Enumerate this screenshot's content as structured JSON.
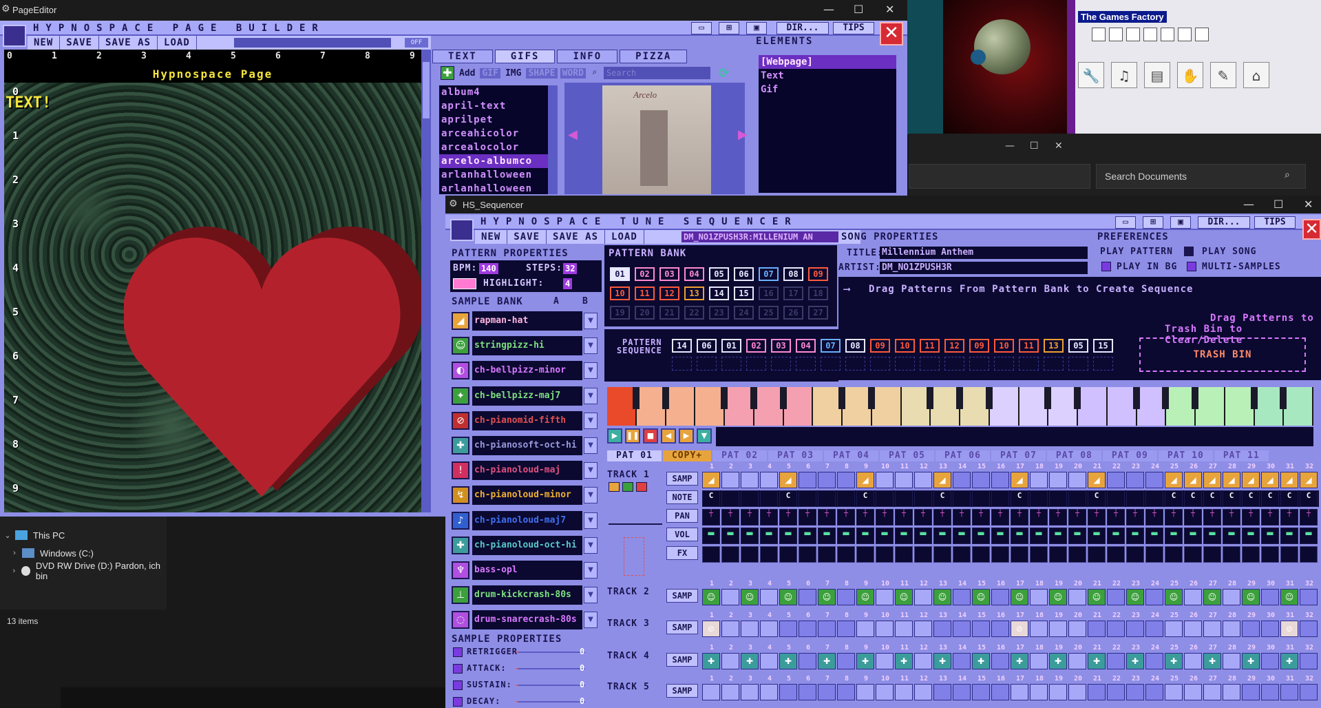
{
  "desktop": {
    "games_factory_title": "The Games Factory",
    "documents_search_placeholder": "Search Documents",
    "explorer": {
      "items": [
        {
          "label": "This PC",
          "level": 0,
          "expanded": true
        },
        {
          "label": "Windows (C:)",
          "level": 1,
          "expanded": false
        },
        {
          "label": "DVD RW Drive (D:) Pardon, ich bin",
          "level": 1,
          "expanded": false
        }
      ],
      "status": "13 items"
    }
  },
  "page_editor": {
    "window_title": "PageEditor",
    "app_title": "HYPNOSPACE PAGE BUILDER",
    "menu": [
      "NEW",
      "SAVE",
      "SAVE AS",
      "LOAD"
    ],
    "toggle_label": "OFF",
    "header_buttons": {
      "dir": "DIR...",
      "tips": "TIPS"
    },
    "page_title": "Hypnospace Page",
    "text_element": "TEXT!",
    "ruler_top": [
      "0",
      "1",
      "2",
      "3",
      "4",
      "5",
      "6",
      "7",
      "8",
      "9"
    ],
    "ruler_left": [
      "0",
      "1",
      "2",
      "3",
      "4",
      "5",
      "6",
      "7",
      "8",
      "9"
    ],
    "tabs": [
      "TEXT",
      "GIFS",
      "INFO",
      "PIZZA"
    ],
    "active_tab": "GIFS",
    "toolbar": {
      "add": "Add",
      "gif": "GIF",
      "img": "IMG",
      "shape": "SHAPE",
      "word": "WORD",
      "search_placeholder": "Search"
    },
    "gifs": [
      "album4",
      "april-text",
      "aprilpet",
      "arceahicolor",
      "arcealocolor",
      "arcelo-albumco",
      "arlanhalloween",
      "arlanhalloween"
    ],
    "selected_gif": "arcelo-albumco",
    "preview_caption": "Arcelo",
    "elements_header": "ELEMENTS",
    "elements": [
      "[Webpage]",
      "Text",
      "Gif"
    ],
    "selected_element": "[Webpage]",
    "colors": {
      "frame": "#8e8ee6",
      "heart": "#b3222c",
      "accent_text": "#f5e53c"
    }
  },
  "sequencer": {
    "window_title": "HS_Sequencer",
    "app_title": "HYPNOSPACE TUNE SEQUENCER",
    "menu": [
      "NEW",
      "SAVE",
      "SAVE AS",
      "LOAD"
    ],
    "song_bar": "DM_NO1ZPUSH3R:MILLENIUM AN",
    "header_buttons": {
      "dir": "DIR...",
      "tips": "TIPS"
    },
    "pattern_properties": {
      "header": "PATTERN PROPERTIES",
      "bpm_label": "BPM:",
      "bpm": "140",
      "steps_label": "STEPS:",
      "steps": "32",
      "highlight_label": "HIGHLIGHT:",
      "highlight": "4"
    },
    "pattern_bank": {
      "header": "PATTERN BANK",
      "cells": [
        "01",
        "02",
        "03",
        "04",
        "05",
        "06",
        "07",
        "08",
        "09",
        "10",
        "11",
        "12",
        "13",
        "14",
        "15",
        "16",
        "17",
        "18",
        "19",
        "20",
        "21",
        "22",
        "23",
        "24",
        "25",
        "26",
        "27"
      ]
    },
    "song_properties": {
      "header": "SONG PROPERTIES",
      "title_label": "TITLE:",
      "title": "Millennium Anthem",
      "artist_label": "ARTIST:",
      "artist": "DM_NO1ZPUSH3R"
    },
    "preferences": {
      "header": "PREFERENCES",
      "play_pattern": "PLAY PATTERN",
      "play_song": "PLAY SONG",
      "play_in_bg": "PLAY IN BG",
      "multi_samples": "MULTI-SAMPLES"
    },
    "drag_hint": "Drag Patterns From Pattern Bank to Create Sequence",
    "trash_hint_1": "Drag Patterns to",
    "trash_hint_2": "Trash Bin to Clear/Delete",
    "trash_bin": "TRASH BIN",
    "pattern_sequence_label_1": "PATTERN",
    "pattern_sequence_label_2": "SEQUENCE",
    "pattern_sequence": [
      "14",
      "06",
      "01",
      "02",
      "03",
      "04",
      "07",
      "08",
      "09",
      "10",
      "11",
      "12",
      "09",
      "10",
      "11",
      "13",
      "05",
      "15"
    ],
    "sample_bank": {
      "header": "SAMPLE BANK",
      "ab": [
        "A",
        "B"
      ],
      "samples": [
        {
          "name": "rapman-hat",
          "color": "#ffb7e0",
          "icon_bg": "#e8a43c",
          "icon": "◢"
        },
        {
          "name": "stringpizz-hi",
          "color": "#7ee07e",
          "icon_bg": "#3ca03c",
          "icon": "☺"
        },
        {
          "name": "ch-bellpizz-minor",
          "color": "#d878ff",
          "icon_bg": "#b04fe0",
          "icon": "◐"
        },
        {
          "name": "ch-bellpizz-maj7",
          "color": "#7ee07e",
          "icon_bg": "#3ca03c",
          "icon": "✦"
        },
        {
          "name": "ch-pianomid-fifth",
          "color": "#e05050",
          "icon_bg": "#c03030",
          "icon": "⊘"
        },
        {
          "name": "ch-pianosoft-oct-hi",
          "color": "#9898d8",
          "icon_bg": "#3c9c9c",
          "icon": "✚"
        },
        {
          "name": "ch-pianoloud-maj",
          "color": "#e05080",
          "icon_bg": "#d03060",
          "icon": "!"
        },
        {
          "name": "ch-pianoloud-minor",
          "color": "#f0b030",
          "icon_bg": "#d09020",
          "icon": "↯"
        },
        {
          "name": "ch-pianoloud-maj7",
          "color": "#4070f0",
          "icon_bg": "#3060d0",
          "icon": "♪"
        },
        {
          "name": "ch-pianoloud-oct-hi",
          "color": "#58c8c8",
          "icon_bg": "#3c9c9c",
          "icon": "✚"
        },
        {
          "name": "bass-opl",
          "color": "#d878ff",
          "icon_bg": "#b04fe0",
          "icon": "♆"
        },
        {
          "name": "drum-kickcrash-80s",
          "color": "#7ee07e",
          "icon_bg": "#3ca03c",
          "icon": "⊥"
        },
        {
          "name": "drum-snarecrash-80s",
          "color": "#d878ff",
          "icon_bg": "#b04fe0",
          "icon": "◌"
        }
      ]
    },
    "sample_properties": {
      "header": "SAMPLE PROPERTIES",
      "rows": [
        {
          "label": "RETRIGGER",
          "value": "0"
        },
        {
          "label": "ATTACK:",
          "value": "0"
        },
        {
          "label": "SUSTAIN:",
          "value": "0"
        },
        {
          "label": "DECAY:",
          "value": "0"
        }
      ]
    },
    "pattern_tabs": [
      "PAT 01",
      "COPY+",
      "PAT 02",
      "PAT 03",
      "PAT 04",
      "PAT 05",
      "PAT 06",
      "PAT 07",
      "PAT 08",
      "PAT 09",
      "PAT 10",
      "PAT 11"
    ],
    "tracks": [
      {
        "label": "TRACK 1",
        "rows": [
          "SAMP",
          "NOTE",
          "PAN",
          "VOL",
          "FX"
        ]
      },
      {
        "label": "TRACK 2",
        "rows": [
          "SAMP"
        ]
      },
      {
        "label": "TRACK 3",
        "rows": [
          "SAMP"
        ]
      },
      {
        "label": "TRACK 4",
        "rows": [
          "SAMP"
        ]
      },
      {
        "label": "TRACK 5",
        "rows": [
          "SAMP"
        ]
      }
    ],
    "track1_hat_steps": [
      1,
      5,
      9,
      13,
      17,
      21,
      25,
      26,
      27,
      28,
      29,
      30,
      31,
      32
    ],
    "track1_note_steps": [
      1,
      5,
      9,
      13,
      17,
      21,
      25,
      26,
      27,
      28,
      29,
      30,
      31,
      32
    ],
    "track1_note_label": "C",
    "track2_steps": [
      1,
      3,
      5,
      7,
      9,
      11,
      13,
      15,
      17,
      19,
      21,
      23,
      25,
      27,
      29,
      31
    ],
    "track3_steps": [
      1,
      17,
      31
    ],
    "track4_steps": [
      1,
      3,
      5,
      7,
      9,
      11,
      13,
      15,
      17,
      19,
      21,
      23,
      25,
      27,
      29,
      31
    ]
  }
}
